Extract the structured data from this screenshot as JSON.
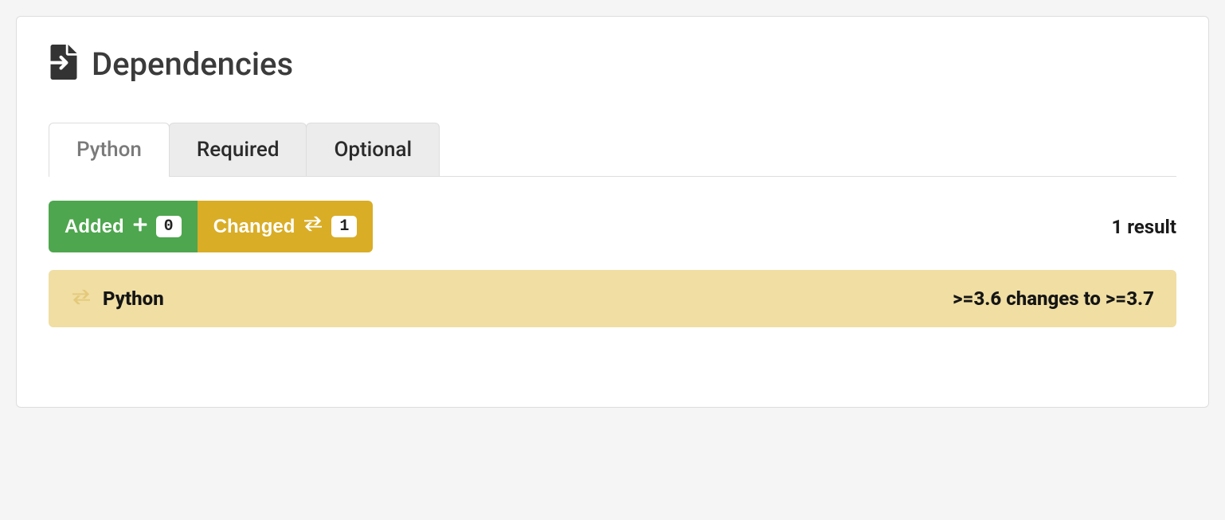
{
  "panel": {
    "title": "Dependencies"
  },
  "tabs": {
    "python": "Python",
    "required": "Required",
    "optional": "Optional"
  },
  "filters": {
    "added_label": "Added",
    "added_count": "0",
    "changed_label": "Changed",
    "changed_count": "1"
  },
  "results": {
    "count_text": "1 result"
  },
  "dependencies": [
    {
      "name": "Python",
      "change": ">=3.6 changes to >=3.7"
    }
  ]
}
